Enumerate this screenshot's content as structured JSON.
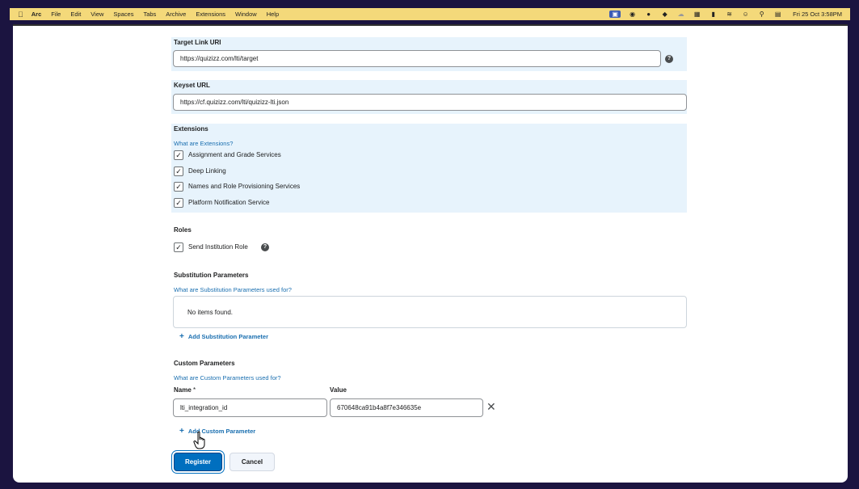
{
  "menubar": {
    "apple_icon": "apple-icon",
    "items": [
      "Arc",
      "File",
      "Edit",
      "View",
      "Spaces",
      "Tabs",
      "Archive",
      "Extensions",
      "Window",
      "Help"
    ],
    "datetime": "Fri 25 Oct  3:58PM"
  },
  "form": {
    "target_link": {
      "label": "Target Link URI",
      "value": "https://quizizz.com/lti/target"
    },
    "keyset": {
      "label": "Keyset URL",
      "value": "https://cf.quizizz.com/lti/quizizz-lti.json"
    },
    "extensions": {
      "label": "Extensions",
      "help_link": "What are Extensions?",
      "options": [
        {
          "label": "Assignment and Grade Services",
          "checked": true
        },
        {
          "label": "Deep Linking",
          "checked": true
        },
        {
          "label": "Names and Role Provisioning Services",
          "checked": true
        },
        {
          "label": "Platform Notification Service",
          "checked": true
        }
      ]
    },
    "roles": {
      "label": "Roles",
      "option": {
        "label": "Send Institution Role",
        "checked": true
      }
    },
    "substitution": {
      "label": "Substitution Parameters",
      "help_link": "What are Substitution Parameters used for?",
      "empty_text": "No items found.",
      "add_label": "Add Substitution Parameter"
    },
    "custom": {
      "label": "Custom Parameters",
      "help_link": "What are Custom Parameters used for?",
      "name_header": "Name",
      "required_mark": "*",
      "value_header": "Value",
      "name_value": "lti_integration_id",
      "value_value": "670648ca91b4a8f7e346635e",
      "add_label": "Add Custom Parameter"
    },
    "buttons": {
      "register": "Register",
      "cancel": "Cancel"
    }
  }
}
